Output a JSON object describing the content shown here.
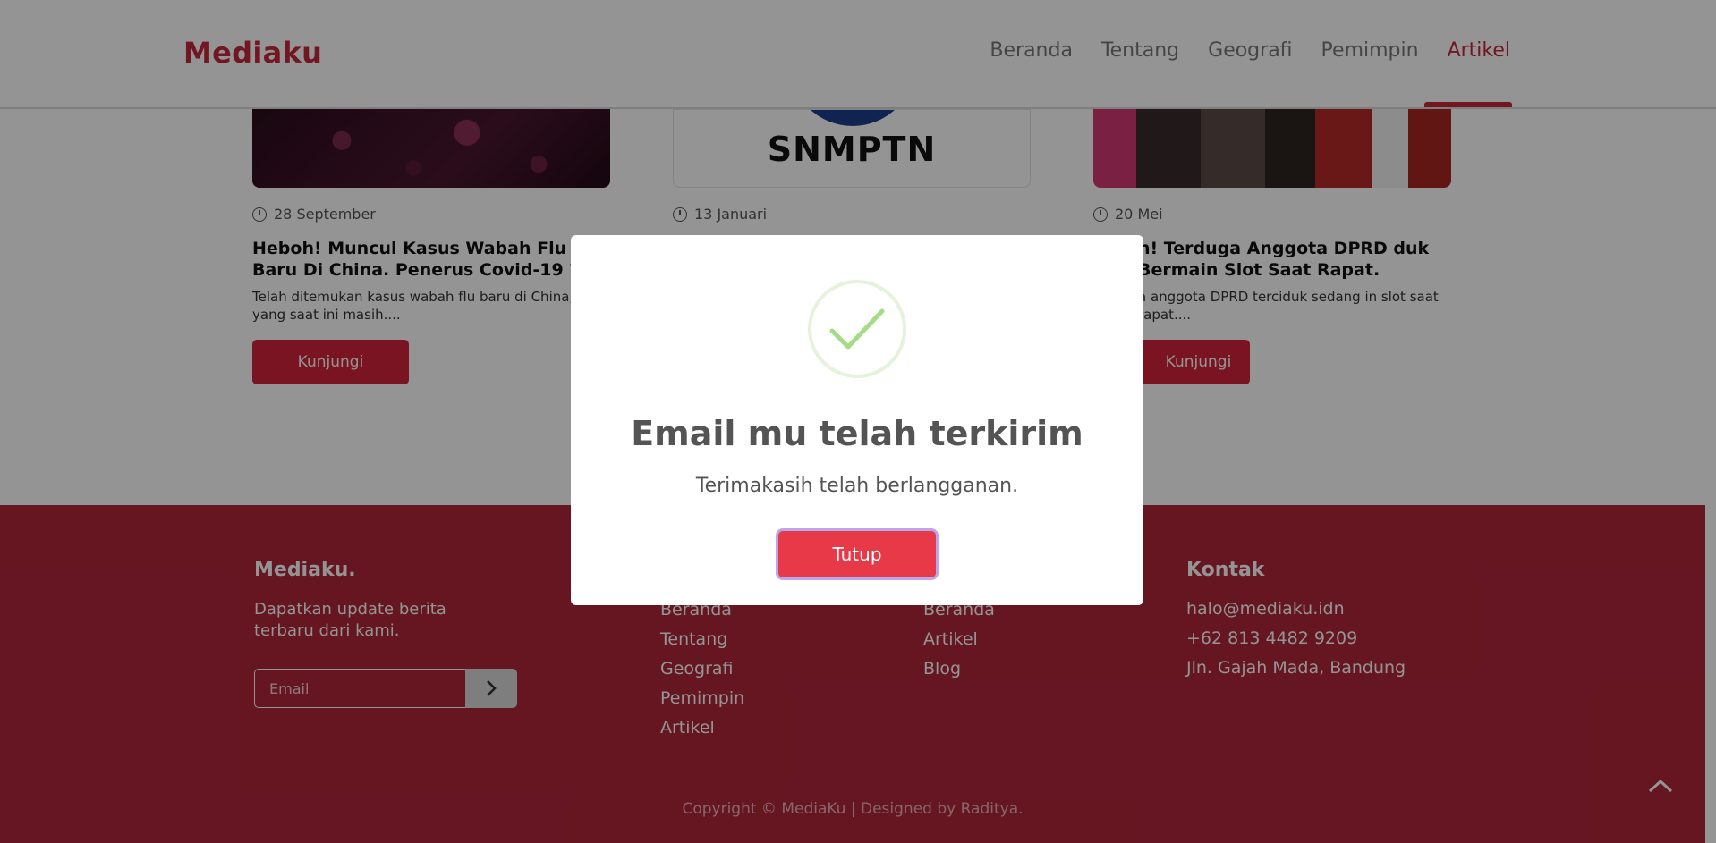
{
  "nav": {
    "brand": "Mediaku",
    "items": [
      {
        "label": "Beranda"
      },
      {
        "label": "Tentang"
      },
      {
        "label": "Geografi"
      },
      {
        "label": "Pemimpin"
      },
      {
        "label": "Artikel",
        "active": true
      }
    ]
  },
  "cards": [
    {
      "date": "28 September",
      "title": "Heboh! Muncul Kasus Wabah Flu Baru Di China. Penerus Covid-19 ?",
      "text": "Telah ditemukan kasus wabah flu baru di China, yang saat ini masih....",
      "button": "Kunjungi"
    },
    {
      "image_text": "SNMPTN",
      "date": "13 Januari"
    },
    {
      "date": "20 Mei",
      "title": "h! Terduga Anggota DPRD duk Bermain Slot Saat Rapat.",
      "text": "a anggota DPRD terciduk sedang in slot saat rapat....",
      "button": "Kunjungi"
    }
  ],
  "footer": {
    "brand": "Mediaku.",
    "description": "Dapatkan update berita terbaru dari kami.",
    "email_placeholder": "Email",
    "col2_links": [
      "Beranda",
      "Tentang",
      "Geografi",
      "Pemimpin",
      "Artikel"
    ],
    "col3_links": [
      "Beranda",
      "Artikel",
      "Blog"
    ],
    "contact_title": "Kontak",
    "contact": [
      "halo@mediaku.idn",
      "+62 813 4482 9209",
      "Jln. Gajah Mada, Bandung"
    ],
    "copyright": "Copyright © MediaKu | Designed by Raditya."
  },
  "modal": {
    "title": "Email mu telah terkirim",
    "message": "Terimakasih telah berlangganan.",
    "button": "Tutup"
  },
  "colors": {
    "brand": "#c5283a",
    "footer_bg": "#b0263a",
    "button": "#d3243c",
    "modal_button": "#e73947",
    "success": "#a5dc86"
  }
}
